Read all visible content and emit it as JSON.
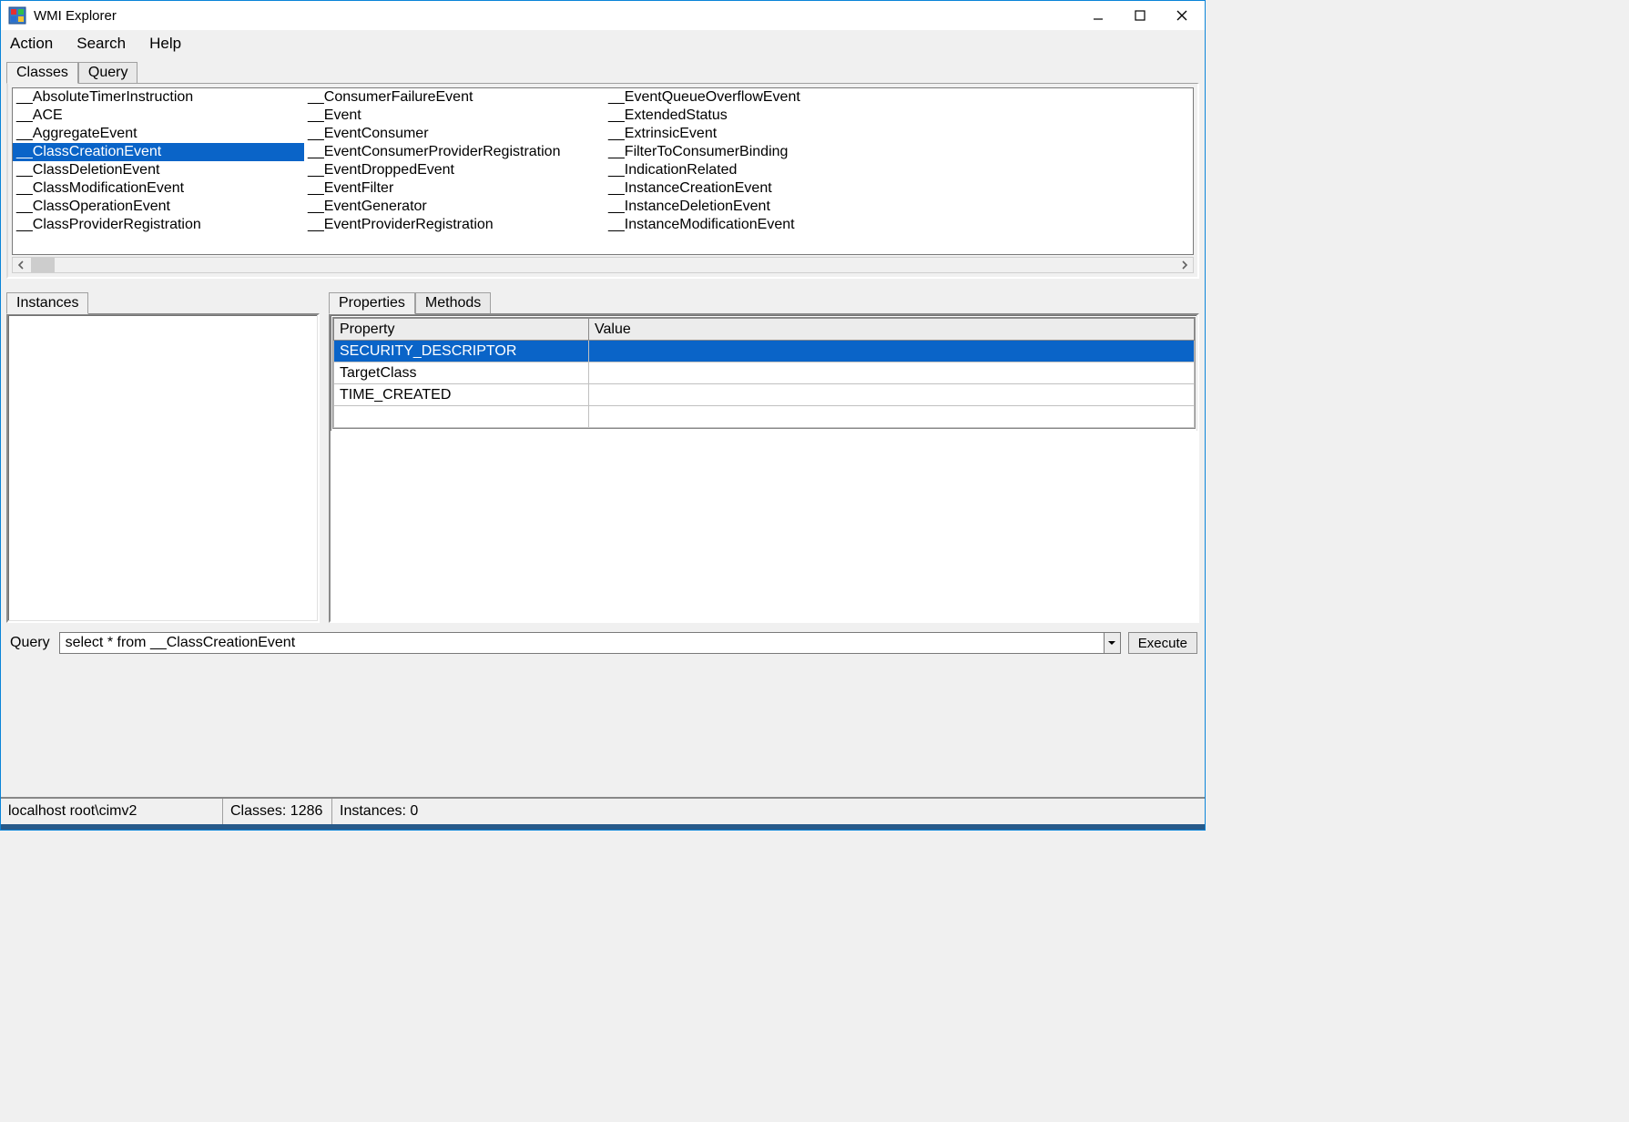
{
  "window": {
    "title": "WMI Explorer"
  },
  "menubar": {
    "action": "Action",
    "search": "Search",
    "help": "Help"
  },
  "tabs_top": {
    "classes": "Classes",
    "query": "Query"
  },
  "class_columns": [
    {
      "items": [
        "__AbsoluteTimerInstruction",
        "__ACE",
        "__AggregateEvent",
        "__ClassCreationEvent",
        "__ClassDeletionEvent",
        "__ClassModificationEvent",
        "__ClassOperationEvent",
        "__ClassProviderRegistration"
      ],
      "selected_index": 3
    },
    {
      "items": [
        "__ConsumerFailureEvent",
        "__Event",
        "__EventConsumer",
        "__EventConsumerProviderRegistration",
        "__EventDroppedEvent",
        "__EventFilter",
        "__EventGenerator",
        "__EventProviderRegistration"
      ]
    },
    {
      "items": [
        "__EventQueueOverflowEvent",
        "__ExtendedStatus",
        "__ExtrinsicEvent",
        "__FilterToConsumerBinding",
        "__IndicationRelated",
        "__InstanceCreationEvent",
        "__InstanceDeletionEvent",
        "__InstanceModificationEvent"
      ]
    }
  ],
  "tabs_mid_left": {
    "instances": "Instances"
  },
  "tabs_mid_right": {
    "properties": "Properties",
    "methods": "Methods"
  },
  "properties_table": {
    "headers": {
      "property": "Property",
      "value": "Value"
    },
    "rows": [
      {
        "property": "SECURITY_DESCRIPTOR",
        "value": "",
        "selected": true
      },
      {
        "property": "TargetClass",
        "value": ""
      },
      {
        "property": "TIME_CREATED",
        "value": ""
      },
      {
        "property": "",
        "value": ""
      }
    ]
  },
  "query_row": {
    "label": "Query",
    "value": "select * from __ClassCreationEvent",
    "execute": "Execute"
  },
  "statusbar": {
    "host_namespace": "localhost  root\\cimv2",
    "classes": "Classes: 1286",
    "instances": "Instances: 0"
  }
}
